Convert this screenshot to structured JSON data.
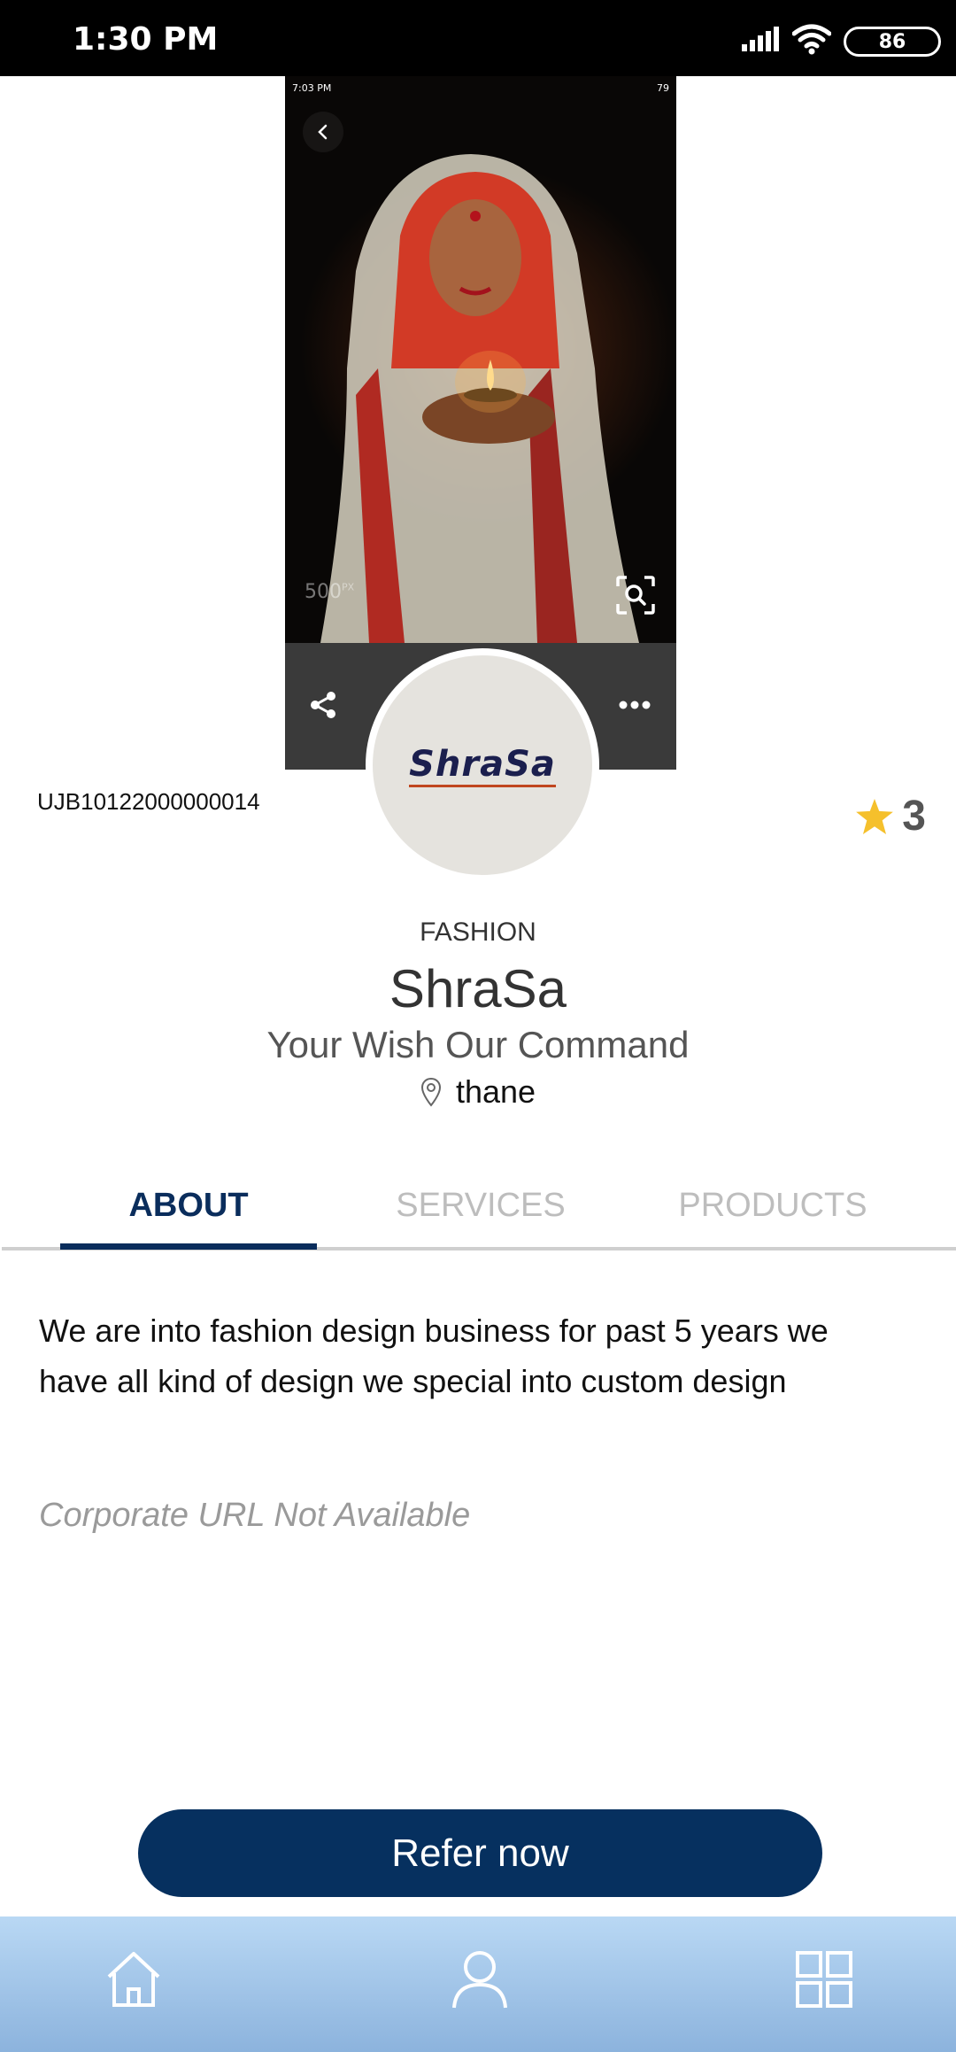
{
  "status_bar": {
    "time": "1:30 PM",
    "battery": "86",
    "icons": [
      "signal-icon",
      "wifi-icon",
      "battery-icon"
    ]
  },
  "cover": {
    "inner_status_time": "7:03 PM",
    "inner_status_battery": "79",
    "watermark": "500",
    "watermark_sup": "PX",
    "icons": [
      "back-icon",
      "zoom-icon",
      "share-icon",
      "more-icon"
    ]
  },
  "avatar": {
    "logo_text": "ShraSa"
  },
  "business": {
    "id": "UJB10122000000014",
    "rating": "3",
    "category": "FASHION",
    "name": "ShraSa",
    "tagline": "Your Wish Our Command",
    "location": "thane"
  },
  "tabs": [
    {
      "label": "ABOUT",
      "active": true
    },
    {
      "label": "SERVICES",
      "active": false
    },
    {
      "label": "PRODUCTS",
      "active": false
    }
  ],
  "about": {
    "description": "We are into fashion design business for past 5 years we have all kind of design we special into custom design",
    "corporate_url": "Corporate URL Not Available"
  },
  "refer_button": {
    "label": "Refer now"
  },
  "bottom_nav": {
    "items": [
      "home-icon",
      "profile-icon",
      "grid-icon"
    ]
  },
  "colors": {
    "primary": "#06305f",
    "tab_active": "#0a2d5c",
    "tab_inactive": "#bdbdbd",
    "star": "#f5c02c",
    "nav_bg_top": "#b9d8f4",
    "nav_bg_bottom": "#8cb3dd"
  }
}
